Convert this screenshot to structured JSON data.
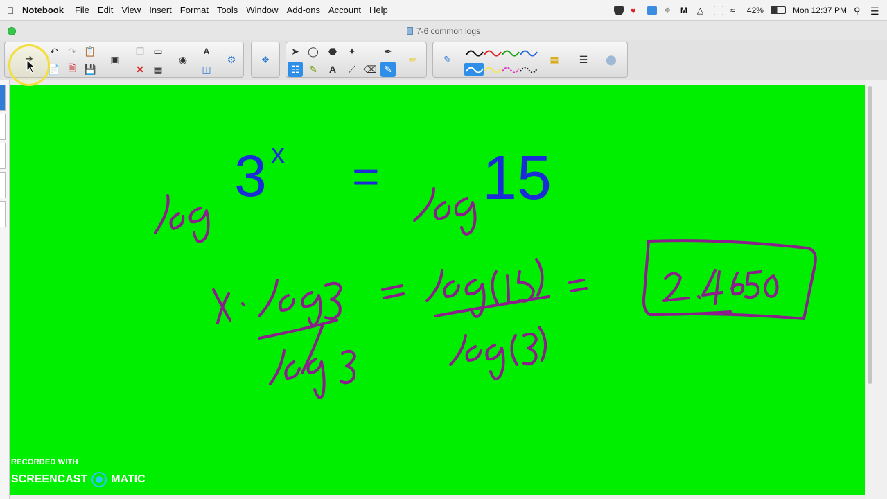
{
  "menubar": {
    "app": "Notebook",
    "items": [
      "File",
      "Edit",
      "View",
      "Insert",
      "Format",
      "Tools",
      "Window",
      "Add-ons",
      "Account",
      "Help"
    ],
    "battery": "42%",
    "clock": "Mon 12:37 PM"
  },
  "window": {
    "title": "7-6 common logs"
  },
  "canvas": {
    "background": "#00ee00",
    "typed": {
      "base": "3",
      "exponent": "x",
      "equals": "=",
      "number": "15"
    },
    "ink_color": "#8a1e8a",
    "typed_color": "#1a2bd8"
  },
  "watermark": {
    "recorded": "RECORDED WITH",
    "brand_left": "SCREENCAST",
    "brand_right": "MATIC"
  },
  "icons": [
    "apple-icon",
    "next-page-icon",
    "undo-icon",
    "redo-icon",
    "select-icon",
    "pen-icon",
    "text-icon",
    "eraser-icon",
    "highlighter-icon",
    "table-icon",
    "gear-icon"
  ]
}
